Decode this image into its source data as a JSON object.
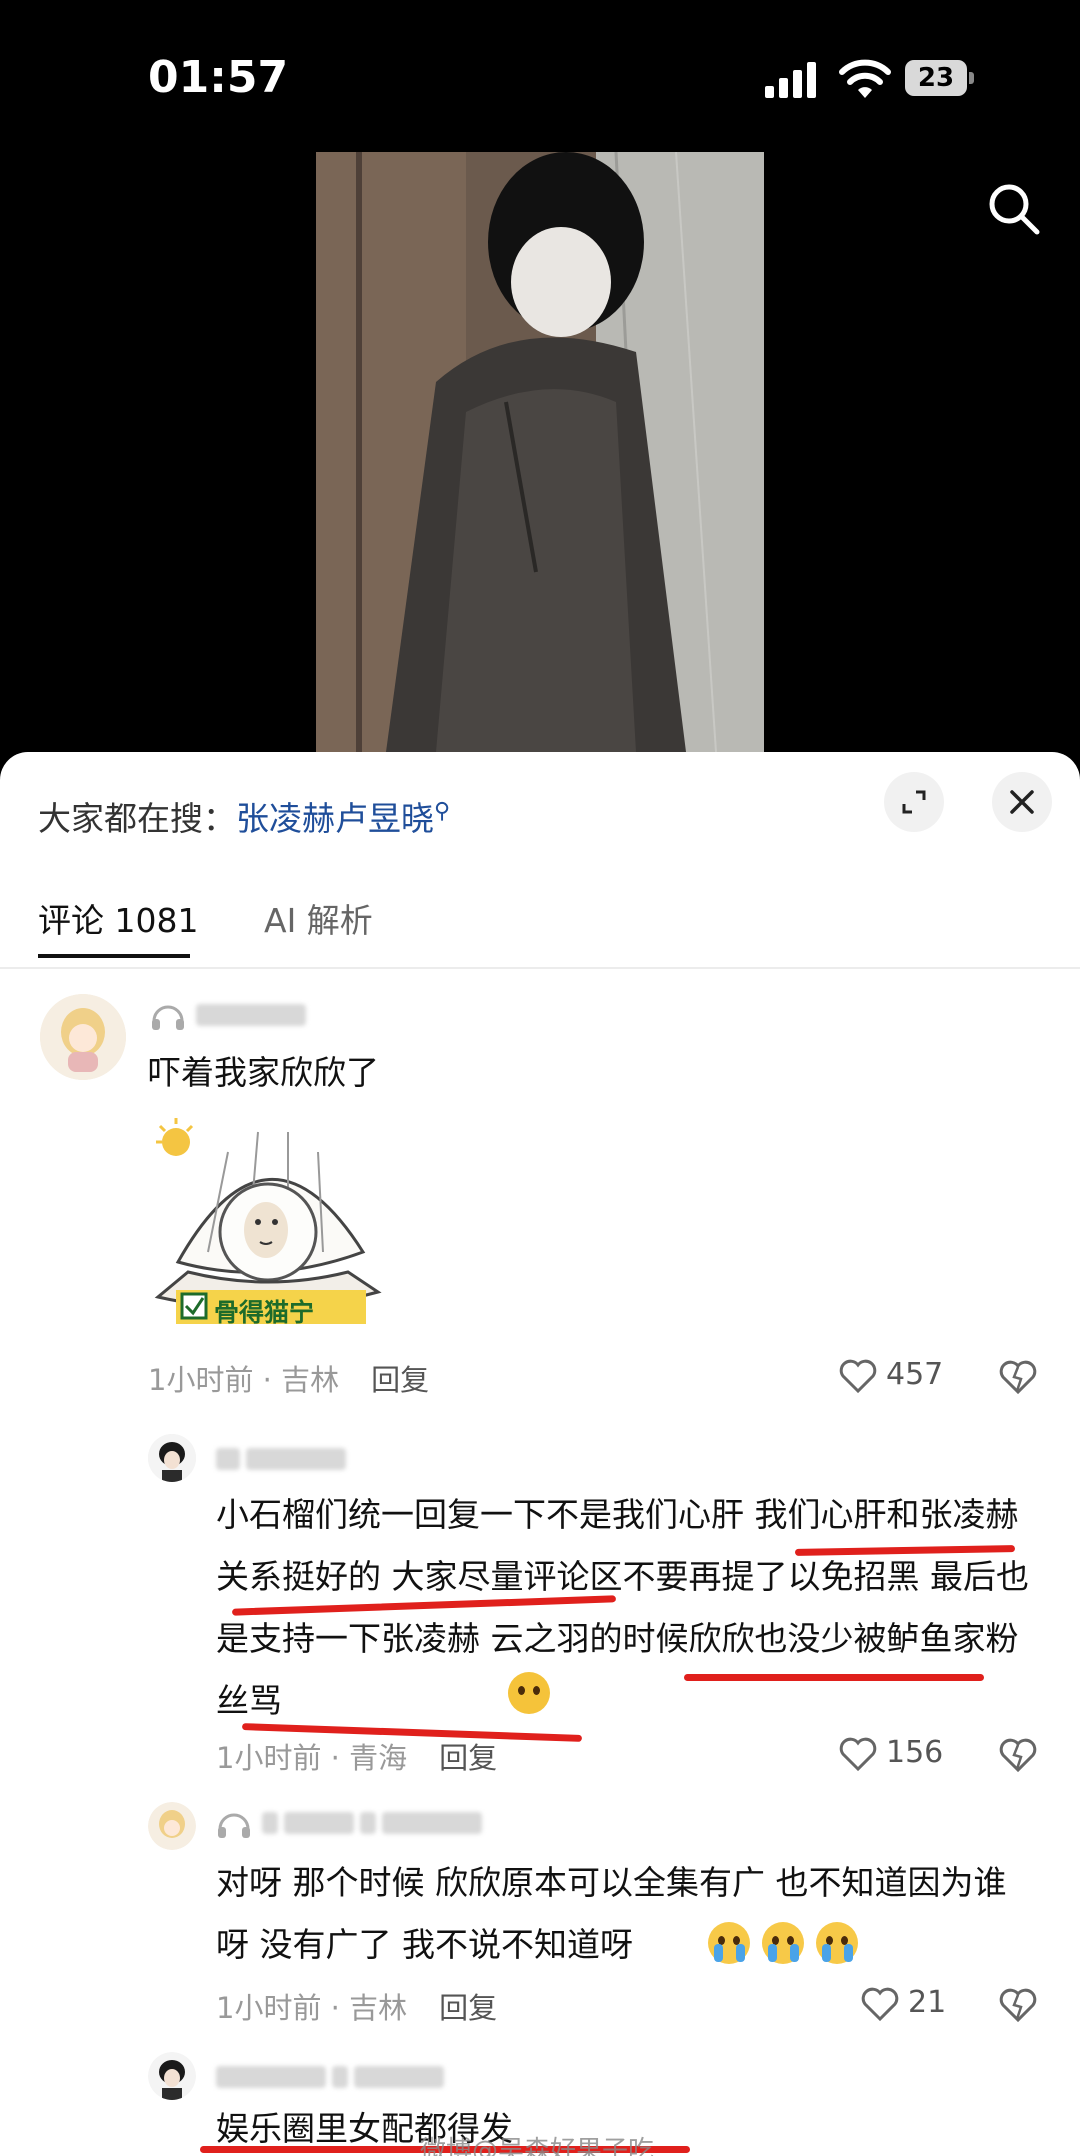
{
  "status_bar": {
    "time": "01:57",
    "battery": "23"
  },
  "trending": {
    "prefix": "大家都在搜：",
    "query": "张凌赫卢昱晓"
  },
  "tabs": [
    {
      "label": "评论 1081"
    },
    {
      "label": "AI 解析"
    }
  ],
  "comments": [
    {
      "text": "吓着我家欣欣了",
      "sticker_caption": "骨得猫宁",
      "meta": "1小时前 · 吉林",
      "reply": "回复",
      "likes": "457"
    },
    {
      "text": "小石榴们统一回复一下不是我们心肝 我们心肝和张凌赫关系挺好的 大家尽量评论区不要再提了以免招黑 最后也是支持一下张凌赫 云之羽的时候欣欣也没少被鲈鱼家粉丝骂",
      "meta": "1小时前 · 青海",
      "reply": "回复",
      "likes": "156"
    },
    {
      "text": "对呀 那个时候 欣欣原本可以全集有广 也不知道因为谁呀 没有广了 我不说不知道呀",
      "meta": "1小时前 · 吉林",
      "reply": "回复",
      "likes": "21"
    },
    {
      "text": "娱乐圈里女配都得发"
    }
  ],
  "watermark": "微博@吴森好果子吃",
  "colors": {
    "accent_link": "#1f4e9a",
    "highlight_red": "#e0201c"
  }
}
